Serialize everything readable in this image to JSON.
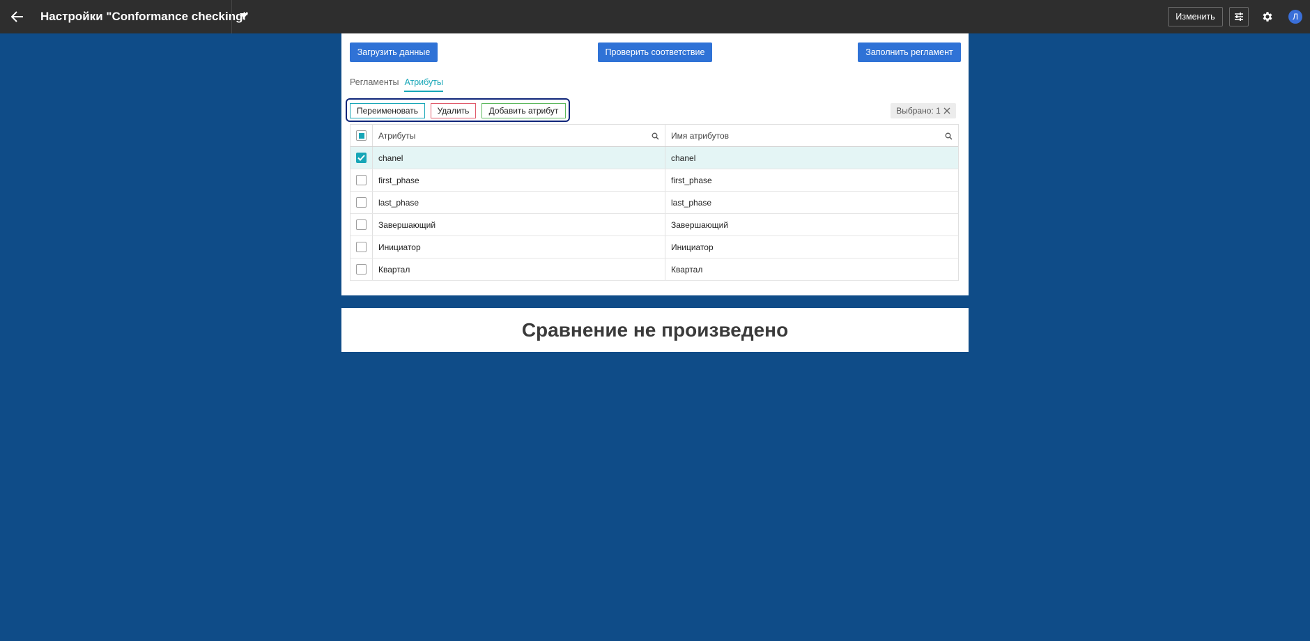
{
  "header": {
    "title": "Настройки \"Conformance checking\"",
    "edit_label": "Изменить",
    "avatar_letter": "Л"
  },
  "toolbar": {
    "load_label": "Загрузить данные",
    "check_label": "Проверить соответствие",
    "fill_label": "Заполнить регламент"
  },
  "tabs": [
    {
      "label": "Регламенты",
      "active": false
    },
    {
      "label": "Атрибуты",
      "active": true
    }
  ],
  "actions": {
    "rename_label": "Переименовать",
    "delete_label": "Удалить",
    "add_label": "Добавить атрибут"
  },
  "selection": {
    "label": "Выбрано: 1"
  },
  "table": {
    "columns": [
      "Атрибуты",
      "Имя атрибутов"
    ],
    "rows": [
      {
        "attr": "chanel",
        "name": "chanel",
        "checked": true
      },
      {
        "attr": "first_phase",
        "name": "first_phase",
        "checked": false
      },
      {
        "attr": "last_phase",
        "name": "last_phase",
        "checked": false
      },
      {
        "attr": "Завершающий",
        "name": "Завершающий",
        "checked": false
      },
      {
        "attr": "Инициатор",
        "name": "Инициатор",
        "checked": false
      },
      {
        "attr": "Квартал",
        "name": "Квартал",
        "checked": false
      }
    ]
  },
  "comparison": {
    "message": "Сравнение не произведено"
  },
  "colors": {
    "page_bg": "#0f4c88",
    "topbar_bg": "#2e2e2e",
    "primary": "#2f72d6",
    "accent": "#17a6b7"
  }
}
